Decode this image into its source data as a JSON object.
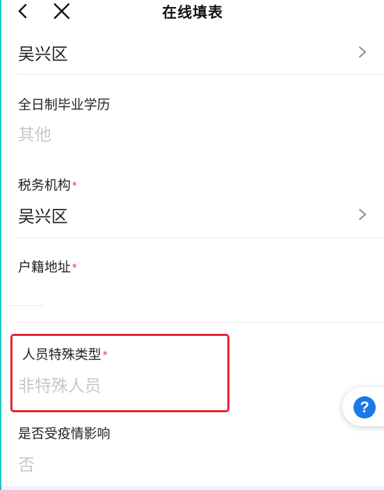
{
  "header": {
    "title": "在线填表"
  },
  "rows": [
    {
      "value": "吴兴区"
    },
    {
      "label": "全日制毕业学历",
      "value": "其他"
    },
    {
      "label": "税务机构",
      "required_mark": "*",
      "value": "吴兴区"
    },
    {
      "label": "户籍地址",
      "required_mark": "*",
      "value": ""
    },
    {
      "label": "人员特殊类型",
      "required_mark": "*",
      "value": "非特殊人员"
    },
    {
      "label": "是否受疫情影响",
      "value": "否"
    }
  ],
  "help": {
    "label": "?"
  },
  "colors": {
    "required": "#e03030",
    "highlight": "#e8202a",
    "help_button": "#1b78e6",
    "placeholder_text": "#c8c8c8"
  },
  "icons": [
    "back-arrow-icon",
    "close-icon",
    "chevron-right-icon",
    "help-icon"
  ]
}
